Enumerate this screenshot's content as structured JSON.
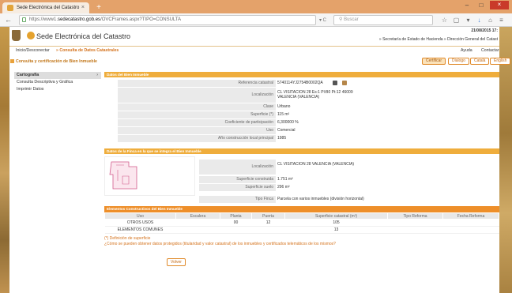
{
  "browser": {
    "tab_title": "Sede Electrónica del Catastro",
    "tab_close": "×",
    "new_tab": "+",
    "win_min": "–",
    "win_max": "□",
    "win_close": "×",
    "url_prefix": "https://www1.",
    "url_host": "sedecatastro.gob.es",
    "url_path": "/OVCFrames.aspx?TIPO=CONSULTA",
    "search_placeholder": "Buscar",
    "back": "←",
    "reload": "▾ C"
  },
  "header": {
    "site_title": "Sede Electrónica del Catastro",
    "date": "21/08/2015 17:",
    "ministerio": "» Secretaría de Estado de Hacienda » Dirección General del Catast"
  },
  "menu": {
    "inicio": "Inicio/Desconectar",
    "consulta_breadcrumb": "» Consulta de Datos Catastrales",
    "ayuda": "Ayuda",
    "contactar": "Contactar"
  },
  "section": {
    "title": "Consulta y certificación de Bien Inmueble",
    "btn_certificar": "Certificar",
    "btn_bilingual": "Dialogo",
    "btn_catala": "Català",
    "btn_english": "English"
  },
  "leftnav": {
    "items": [
      "Cartografía",
      "Consulta Descriptiva y Gráfica",
      "Imprimir Datos"
    ],
    "chevron": "›"
  },
  "inmueble": {
    "bar": "Datos del Bien Inmueble",
    "rows": [
      {
        "label": "Referencia catastral",
        "value": "5740114YJ2754B0002QA"
      },
      {
        "label": "Localización",
        "value": "CL VISITACION 28 Es:1 Pl:B0 Pt:12 46009 VALENCIA (VALENCIA)"
      },
      {
        "label": "Clase",
        "value": "Urbano"
      },
      {
        "label": "Superficie (*)",
        "value": "115 m²"
      },
      {
        "label": "Coeficiente de participación",
        "value": "6,300000 %"
      },
      {
        "label": "Uso",
        "value": "Comercial"
      },
      {
        "label": "Año construcción local principal",
        "value": "1985"
      }
    ]
  },
  "finca": {
    "bar": "Datos de la Finca en la que se integra el Bien Inmueble",
    "rows": [
      {
        "label": "Localización",
        "value": "CL VISITACION 28 VALENCIA (VALENCIA)"
      },
      {
        "label": "Superficie construida",
        "value": "1.751 m²"
      },
      {
        "label": "Superficie suelo",
        "value": "296 m²"
      },
      {
        "label": "Tipo Finca",
        "value": "Parcela con varios inmuebles (división horizontal)"
      }
    ]
  },
  "constructivos": {
    "bar": "Elementos Constructivos del Bien Inmueble",
    "columns": [
      "Uso",
      "Escalera",
      "Planta",
      "Puerta",
      "Superficie catastral (m²)",
      "Tipo Reforma",
      "Fecha Reforma"
    ],
    "rows": [
      [
        "OTROS USOS",
        "",
        "00",
        "12",
        "105",
        "",
        ""
      ],
      [
        "ELEMENTOS COMUNES",
        "",
        "",
        "",
        "13",
        "",
        ""
      ]
    ]
  },
  "notes": {
    "definicion": "(*) Definición de superficie",
    "pregunta": "¿Cómo se pueden obtener datos protegidos (titularidad y valor catastral) de los inmuebles y certificados telemáticos de los mismos?"
  },
  "volver": "Volver",
  "colors": {
    "accent": "#efad3c",
    "accent_dark": "#ee8f2a",
    "link": "#d4721c"
  }
}
